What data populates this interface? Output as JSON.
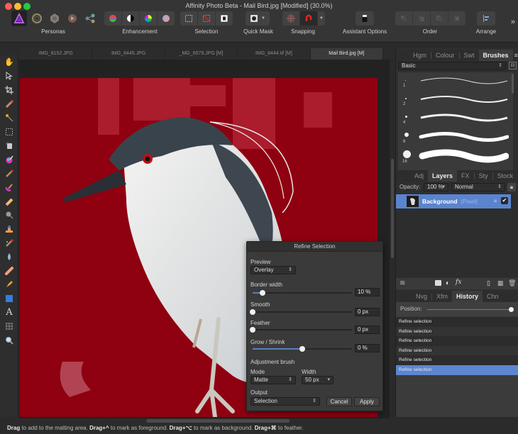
{
  "window": {
    "title": "Affinity Photo Beta - Mail Bird.jpg [Modified] (30.0%)"
  },
  "toolbar": {
    "groups": [
      {
        "label": "Personas",
        "icons": [
          "photo-persona-icon",
          "liquify-persona-icon",
          "develop-persona-icon",
          "tone-mapping-persona-icon",
          "export-persona-icon"
        ]
      },
      {
        "label": "Enhancement",
        "icons": [
          "levels-icon",
          "white-balance-icon",
          "hsl-icon",
          "auto-contrast-icon"
        ]
      },
      {
        "label": "Selection",
        "icons": [
          "select-all-icon",
          "deselect-icon",
          "invert-selection-icon"
        ]
      },
      {
        "label": "Quick Mask",
        "icons": [
          "quick-mask-icon"
        ]
      },
      {
        "label": "Snapping",
        "icons": [
          "snapping-grid-icon",
          "snapping-magnet-icon"
        ]
      },
      {
        "label": "Assistant Options",
        "icons": [
          "assistant-icon"
        ]
      },
      {
        "label": "Order",
        "icons": [
          "move-to-back-icon",
          "move-back-icon",
          "move-forward-icon",
          "move-to-front-icon"
        ]
      },
      {
        "label": "Arrange",
        "icons": [
          "align-icon"
        ]
      }
    ],
    "overflow": "»"
  },
  "left_tools": [
    "hand-tool",
    "move-tool",
    "crop-tool",
    "selection-brush-tool",
    "flood-select-tool",
    "marquee-tool",
    "flood-fill-tool",
    "gradient-tool",
    "paint-brush-tool",
    "color-replacement-tool",
    "erase-brush-tool",
    "dodge-tool",
    "clone-tool",
    "inpainting-tool",
    "blur-tool",
    "healing-tool",
    "pen-tool",
    "rectangle-tool",
    "text-tool",
    "mesh-warp-tool",
    "zoom-tool"
  ],
  "doc_tabs": [
    {
      "label": "IMG_8152.JPG",
      "active": false
    },
    {
      "label": "IMG_8445.JPG",
      "active": false
    },
    {
      "label": "_MG_6579.JPG [M]",
      "active": false
    },
    {
      "label": "IMG_8444.tif [M]",
      "active": false
    },
    {
      "label": "Mail Bird.jpg [M]",
      "active": true
    }
  ],
  "refine_selection": {
    "title": "Refine Selection",
    "preview_label": "Preview",
    "preview_value": "Overlay",
    "border_width": {
      "label": "Border width",
      "value": "10 %",
      "fraction": 0.1
    },
    "smooth": {
      "label": "Smooth",
      "value": "0 px",
      "fraction": 0.0
    },
    "feather": {
      "label": "Feather",
      "value": "0 px",
      "fraction": 0.0
    },
    "grow_shrink": {
      "label": "Grow / Shrink",
      "value": "0 %",
      "fraction": 0.5
    },
    "adjustment_brush_label": "Adjustment brush",
    "mode_label": "Mode",
    "mode_value": "Matte",
    "width_label": "Width",
    "width_value": "50 px",
    "output_label": "Output",
    "output_value": "Selection",
    "cancel_label": "Cancel",
    "apply_label": "Apply"
  },
  "right_panel": {
    "top_tabs": [
      {
        "label": "Hgm",
        "active": false
      },
      {
        "label": "Colour",
        "active": false
      },
      {
        "label": "Swt",
        "active": false
      },
      {
        "label": "Brushes",
        "active": true
      }
    ],
    "brush_category": "Basic",
    "brushes": [
      {
        "size": "1"
      },
      {
        "size": "2"
      },
      {
        "size": "4"
      },
      {
        "size": "8"
      },
      {
        "size": "16"
      }
    ],
    "mid_tabs": [
      {
        "label": "Adj",
        "active": false
      },
      {
        "label": "Layers",
        "active": true
      },
      {
        "label": "FX",
        "active": false
      },
      {
        "label": "Sty",
        "active": false
      },
      {
        "label": "Stock",
        "active": false
      }
    ],
    "opacity_label": "Opacity:",
    "opacity_value": "100 %",
    "blend_mode": "Normal",
    "layer": {
      "name": "Background",
      "type": "(Pixel)",
      "visible": true,
      "locked": true
    },
    "bottom_tabs": [
      {
        "label": "Nvg",
        "active": false
      },
      {
        "label": "Xfm",
        "active": false
      },
      {
        "label": "History",
        "active": true
      },
      {
        "label": "Chn",
        "active": false
      }
    ],
    "history_position_label": "Position:",
    "history_position": 1.0,
    "history": [
      "Refine selection",
      "Refine selection",
      "Refine selection",
      "Refine selection",
      "Refine selection",
      "Refine selection"
    ],
    "history_selected_index": 5
  },
  "status": {
    "parts": [
      {
        "b": "Drag",
        "t": " to add to the matting area. "
      },
      {
        "b": "Drag+^",
        "t": " to mark as foreground. "
      },
      {
        "b": "Drag+⌥",
        "t": " to mark as background. "
      },
      {
        "b": "Drag+⌘",
        "t": " to feather."
      }
    ]
  },
  "colors": {
    "accent": "#5b84cf",
    "overlay_red": "#8f0010",
    "panel_bg": "#2f2f2f"
  }
}
